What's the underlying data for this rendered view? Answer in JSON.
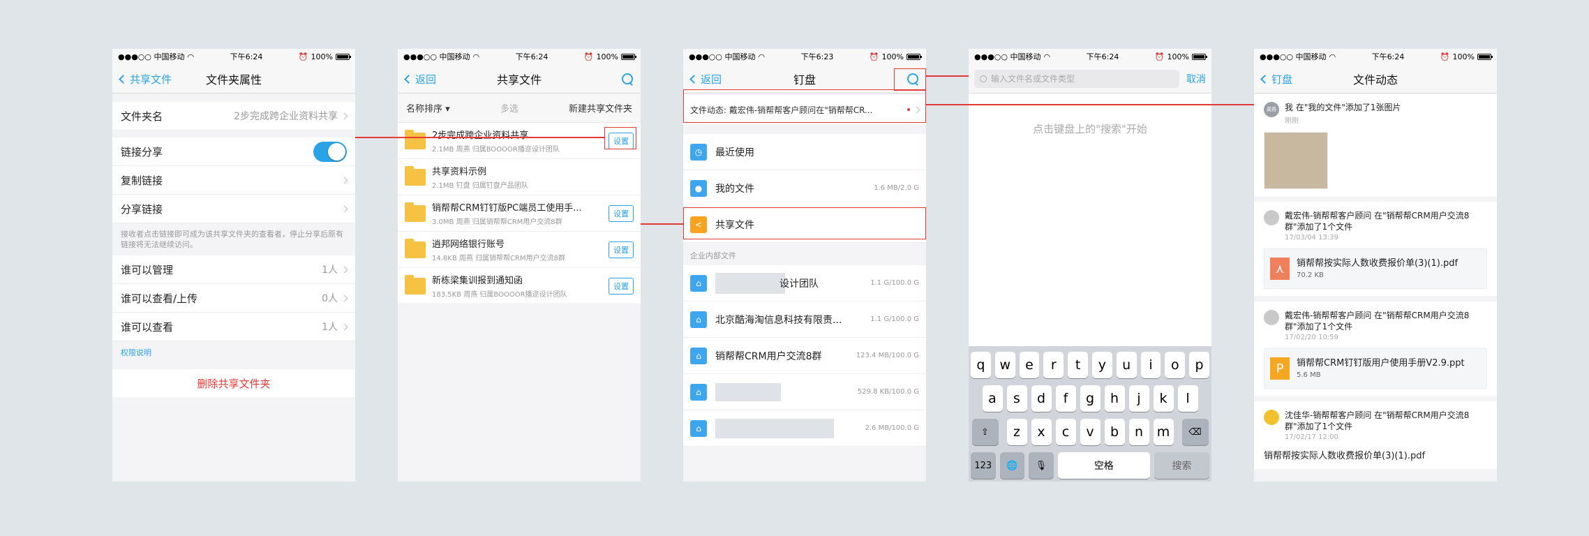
{
  "status": {
    "carrier": "●●●○○ 中国移动",
    "battery": "100%",
    "times": [
      "下午6:24",
      "下午6:24",
      "下午6:23",
      "下午6:24",
      "下午6:24"
    ]
  },
  "s1": {
    "back": "共享文件",
    "title": "文件夹属性",
    "folder_name_label": "文件夹名",
    "folder_name_value": "2步完成跨企业资料共享",
    "link_share": "链接分享",
    "copy_link": "复制链接",
    "share_link": "分享链接",
    "hint": "接收者点击链接即可成为该共享文件夹的查看者，停止分享后原有链接将无法继续访问。",
    "manage_label": "谁可以管理",
    "manage_value": "1人",
    "upload_label": "谁可以查看/上传",
    "upload_value": "0人",
    "view_label": "谁可以查看",
    "view_value": "1人",
    "perm_note": "权限说明",
    "delete": "删除共享文件夹"
  },
  "s2": {
    "back": "返回",
    "title": "共享文件",
    "sort": "名称排序",
    "multi": "多选",
    "new_folder": "新建共享文件夹",
    "set": "设置",
    "folders": [
      {
        "name": "2步完成跨企业资料共享",
        "meta": "2.1MB  周燕  归属BOOOOR播迩设计团队"
      },
      {
        "name": "共享资料示例",
        "meta": "2.1MB  钉盘  归属钉盘产品团队"
      },
      {
        "name": "销帮帮CRM钉钉版PC端员工使用手...",
        "meta": "3.0MB  周燕  归属销帮帮CRM用户交流8群"
      },
      {
        "name": "逍邦网络银行账号",
        "meta": "14.8KB  周燕  归属销帮帮CRM用户交流8群"
      },
      {
        "name": "新栋梁集训报到通知函",
        "meta": "183.5KB  周燕  归属BOOOOR播迩设计团队"
      }
    ]
  },
  "s3": {
    "back": "返回",
    "title": "钉盘",
    "dynamic": "文件动态:  戴宏伟-销帮帮客户顾问在\"销帮帮CR...",
    "recent": "最近使用",
    "mine": "我的文件",
    "mine_size": "1.6 MB/2.0 G",
    "shared": "共享文件",
    "section": "企业内部文件",
    "corp": [
      {
        "name": "设计团队",
        "size": "1.1 G/100.0 G"
      },
      {
        "name": "北京酷海淘信息科技有限责...",
        "size": "1.1 G/100.0 G"
      },
      {
        "name": "销帮帮CRM用户交流8群",
        "size": "123.4 MB/100.0 G"
      },
      {
        "name": "",
        "size": "529.8 KB/100.0 G"
      },
      {
        "name": "",
        "size": "2.6 MB/100.0 G"
      }
    ]
  },
  "s4": {
    "placeholder": "输入文件名或文件类型",
    "cancel": "取消",
    "prompt": "点击键盘上的\"搜索\"开始",
    "row1": [
      "q",
      "w",
      "e",
      "r",
      "t",
      "y",
      "u",
      "i",
      "o",
      "p"
    ],
    "row2": [
      "a",
      "s",
      "d",
      "f",
      "g",
      "h",
      "j",
      "k",
      "l"
    ],
    "row3": [
      "z",
      "x",
      "c",
      "v",
      "b",
      "n",
      "m"
    ],
    "num": "123",
    "space": "空格",
    "search": "搜索"
  },
  "s5": {
    "back": "钉盘",
    "title": "文件动态",
    "feeds": [
      {
        "avatar": "周燕",
        "text": "我 在\"我的文件\"添加了1张图片",
        "time": "刚刚"
      },
      {
        "text": "戴宏伟-销帮帮客户顾问 在\"销帮帮CRM用户交流8群\"添加了1个文件",
        "time": "17/03/04 13:39",
        "file": "销帮帮按实际人数收费报价单(3)(1).pdf",
        "size": "70.2 KB"
      },
      {
        "text": "戴宏伟-销帮帮客户顾问 在\"销帮帮CRM用户交流8群\"添加了1个文件",
        "time": "17/02/20 10:59",
        "file": "销帮帮CRM钉钉版用户使用手册V2.9.ppt",
        "size": "5.6 MB"
      },
      {
        "text": "沈佳华-销帮帮客户顾问 在\"销帮帮CRM用户交流8群\"添加了1个文件",
        "time": "17/02/17 12:00",
        "file": "销帮帮按实际人数收费报价单(3)(1).pdf"
      }
    ]
  },
  "colors": {
    "accent": "#2aa2e6",
    "annotation": "#e53935",
    "folder": "#f5c243"
  }
}
